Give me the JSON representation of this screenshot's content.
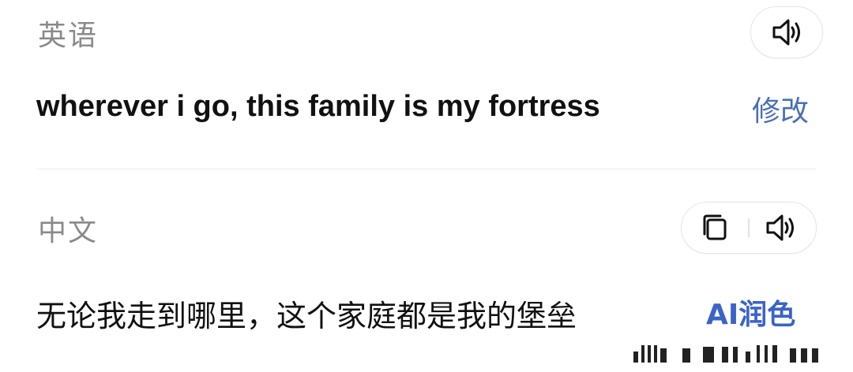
{
  "source": {
    "language": "英语",
    "text": "wherever i go, this family is my fortress",
    "edit_label": "修改",
    "speaker_icon": "speaker-icon"
  },
  "target": {
    "language": "中文",
    "text": "无论我走到哪里，这个家庭都是我的堡垒",
    "polish_label": "AI润色",
    "copy_icon": "copy-icon",
    "speaker_icon": "speaker-icon"
  },
  "colors": {
    "label_gray": "#8a8a8a",
    "link_blue": "#4a6fb5",
    "ai_blue": "#3b63c8",
    "text_dark": "#111111"
  }
}
